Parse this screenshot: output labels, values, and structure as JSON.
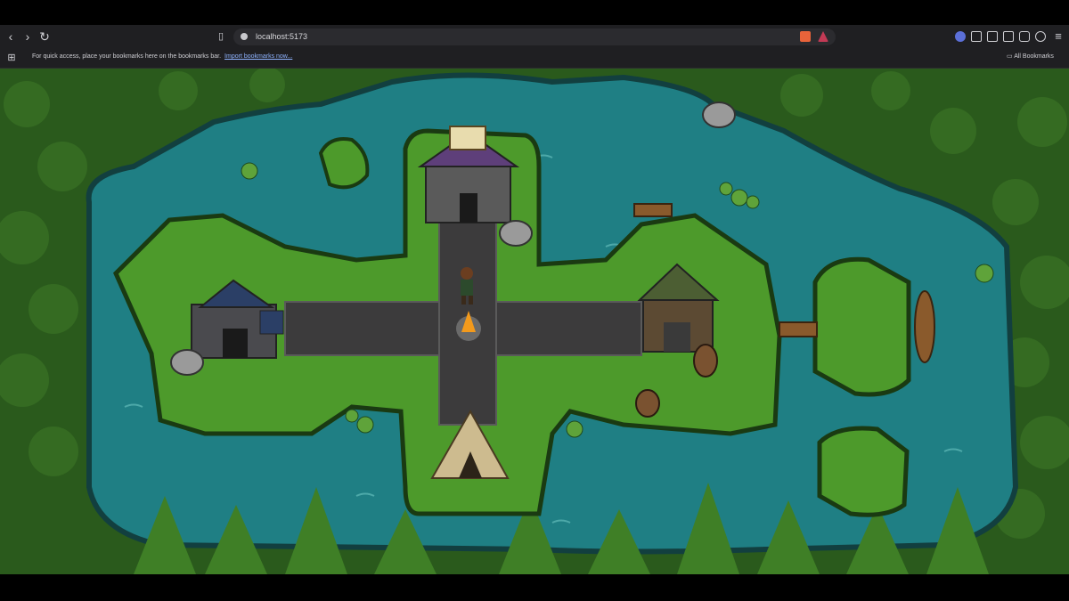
{
  "browser": {
    "url": "localhost:5173",
    "bookmarks_bar_message": "For quick access, place your bookmarks here on the bookmarks bar.",
    "import_bookmarks_link": "Import bookmarks now...",
    "all_bookmarks_label": "All Bookmarks",
    "icons": {
      "back": "back-arrow-icon",
      "forward": "forward-arrow-icon",
      "reload": "reload-icon",
      "bookmark": "bookmark-icon",
      "apps": "apps-grid-icon",
      "folder": "folder-icon"
    }
  },
  "game": {
    "scene": "pixel-art village island hub",
    "buildings": [
      "library-shrine",
      "blacksmith-forge",
      "wooden-barn-shop",
      "canvas-tent"
    ],
    "colors": {
      "water": "#1f7f84",
      "grass": "#4d9a2b",
      "path": "#3c3b3c",
      "forest": "#2e5e1e"
    }
  }
}
